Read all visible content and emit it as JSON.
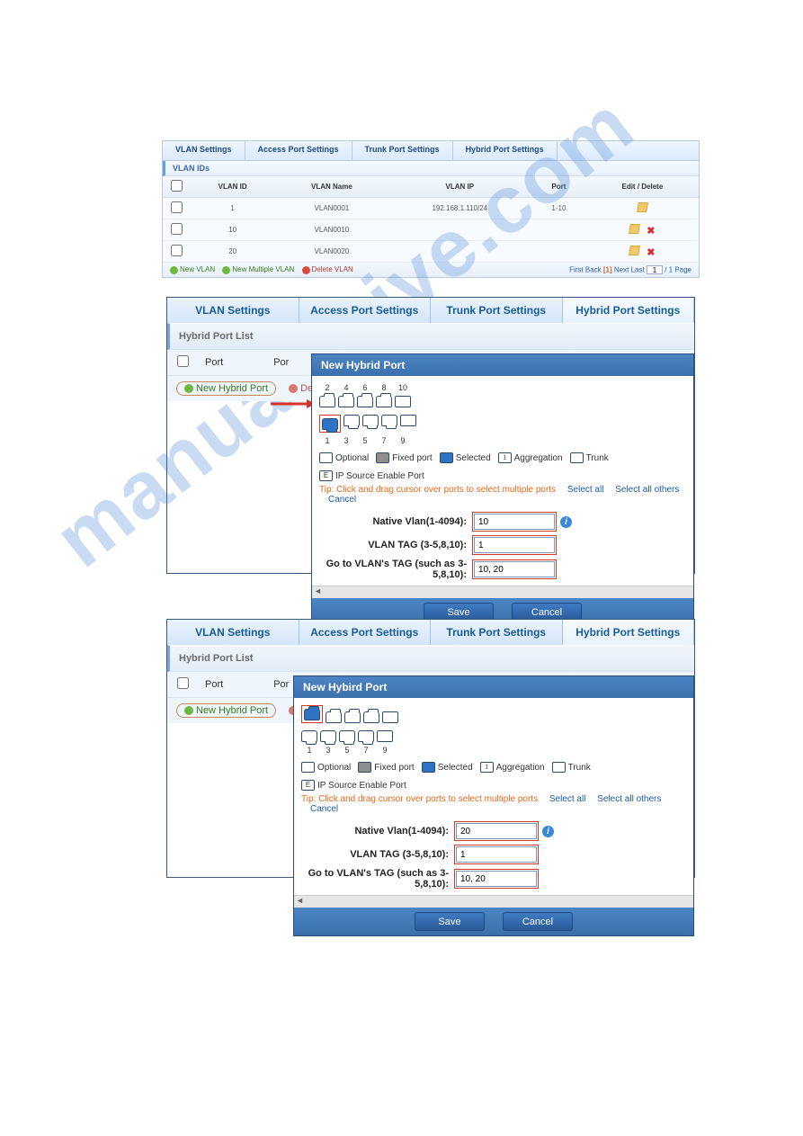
{
  "p1": {
    "tabs": [
      "VLAN Settings",
      "Access Port Settings",
      "Trunk Port Settings",
      "Hybrid Port Settings"
    ],
    "section": "VLAN IDs",
    "headers": [
      "",
      "VLAN ID",
      "VLAN Name",
      "VLAN IP",
      "Port",
      "Edit / Delete"
    ],
    "rows": [
      {
        "id": "1",
        "name": "VLAN0001",
        "ip": "192.168.1.110/24",
        "port": "1-10",
        "editOnly": true
      },
      {
        "id": "10",
        "name": "VLAN0010",
        "ip": "",
        "port": "",
        "editOnly": false
      },
      {
        "id": "20",
        "name": "VLAN0020",
        "ip": "",
        "port": "",
        "editOnly": false
      }
    ],
    "footerLinks": {
      "new": "New VLAN",
      "newMulti": "New Multiple VLAN",
      "del": "Delete VLAN"
    },
    "pager": {
      "first": "First",
      "back": "Back",
      "cur": "[1]",
      "next": "Next",
      "last": "Last",
      "page": "1",
      "of": "/ 1 Page"
    }
  },
  "tabs2": [
    "VLAN Settings",
    "Access Port Settings",
    "Trunk Port Settings",
    "Hybrid Port Settings"
  ],
  "list": {
    "title": "Hybrid Port List",
    "col": "Port",
    "colTrunc": "Por",
    "new": "New Hybrid Port",
    "del": "Delete S",
    "del2": "Delete"
  },
  "dlg": {
    "title": "New Hybrid Port",
    "topNums": [
      "2",
      "4",
      "6",
      "8",
      "10"
    ],
    "botNums": [
      "1",
      "3",
      "5",
      "7",
      "9"
    ],
    "legend": {
      "opt": "Optional",
      "fixed": "Fixed port",
      "sel": "Selected",
      "agg": "Aggregation",
      "trunk": "Trunk",
      "ip": "IP Source Enable Port",
      "aggGlyph": "1",
      "ipGlyph": "E"
    },
    "tip": "Tip:  Click and drag cursor over ports to select multiple ports",
    "selAll": "Select all",
    "selOthers": "Select all others",
    "cancelSel": "Cancel",
    "labels": {
      "native": "Native Vlan(1-4094):",
      "tag": "VLAN TAG (3-5,8,10):",
      "goto": "Go to VLAN's TAG (such as 3-5,8,10):"
    },
    "btns": {
      "save": "Save",
      "cancel": "Cancel"
    }
  },
  "panel2": {
    "native": "10",
    "tag": "1",
    "goto": "10, 20",
    "selectedPortBottom": "1"
  },
  "panel3": {
    "title": "New Hybird Port",
    "native": "20",
    "tag": "1",
    "goto": "10, 20",
    "selectedPortTop": "2"
  },
  "watermark": "manualshive.com"
}
